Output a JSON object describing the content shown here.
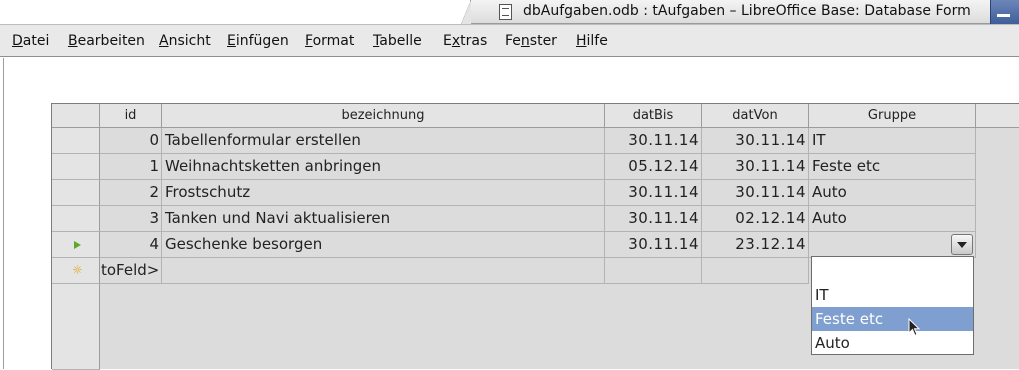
{
  "window": {
    "title": "dbAufgaben.odb : tAufgaben – LibreOffice Base: Database Form"
  },
  "menu": [
    {
      "label": "Datei",
      "mnemonic": "D",
      "rest": "atei"
    },
    {
      "label": "Bearbeiten",
      "mnemonic": "B",
      "rest": "earbeiten"
    },
    {
      "label": "Ansicht",
      "mnemonic": "A",
      "rest": "nsicht"
    },
    {
      "label": "Einfügen",
      "mnemonic": "E",
      "rest": "infügen"
    },
    {
      "label": "Format",
      "mnemonic": "F",
      "rest": "ormat"
    },
    {
      "label": "Tabelle",
      "mnemonic": "T",
      "rest": "abelle"
    },
    {
      "label": "Extras",
      "mnemonic": "x",
      "pre": "E",
      "rest": "tras"
    },
    {
      "label": "Fenster",
      "mnemonic": "n",
      "pre": "Fe",
      "rest": "ster"
    },
    {
      "label": "Hilfe",
      "mnemonic": "H",
      "rest": "ilfe"
    }
  ],
  "grid": {
    "columns": [
      "id",
      "bezeichnung",
      "datBis",
      "datVon",
      "Gruppe"
    ],
    "rows": [
      {
        "id": "0",
        "bezeichnung": "Tabellenformular erstellen",
        "datBis": "30.11.14",
        "datVon": "30.11.14",
        "Gruppe": "IT"
      },
      {
        "id": "1",
        "bezeichnung": "Weihnachtsketten anbringen",
        "datBis": "05.12.14",
        "datVon": "30.11.14",
        "Gruppe": "Feste etc"
      },
      {
        "id": "2",
        "bezeichnung": "Frostschutz",
        "datBis": "30.11.14",
        "datVon": "30.11.14",
        "Gruppe": "Auto"
      },
      {
        "id": "3",
        "bezeichnung": "Tanken und Navi aktualisieren",
        "datBis": "30.11.14",
        "datVon": "02.12.14",
        "Gruppe": "Auto"
      },
      {
        "id": "4",
        "bezeichnung": "Geschenke besorgen",
        "datBis": "30.11.14",
        "datVon": "23.12.14",
        "Gruppe": ""
      }
    ],
    "new_row_text": "toFeld>",
    "current_row_icon": "play-arrow-icon",
    "new_row_icon": "new-record-star-icon"
  },
  "dropdown": {
    "options": [
      "",
      "IT",
      "Feste etc",
      "Auto"
    ],
    "highlighted": "Feste etc",
    "selection_color": "#7f9fd1"
  }
}
